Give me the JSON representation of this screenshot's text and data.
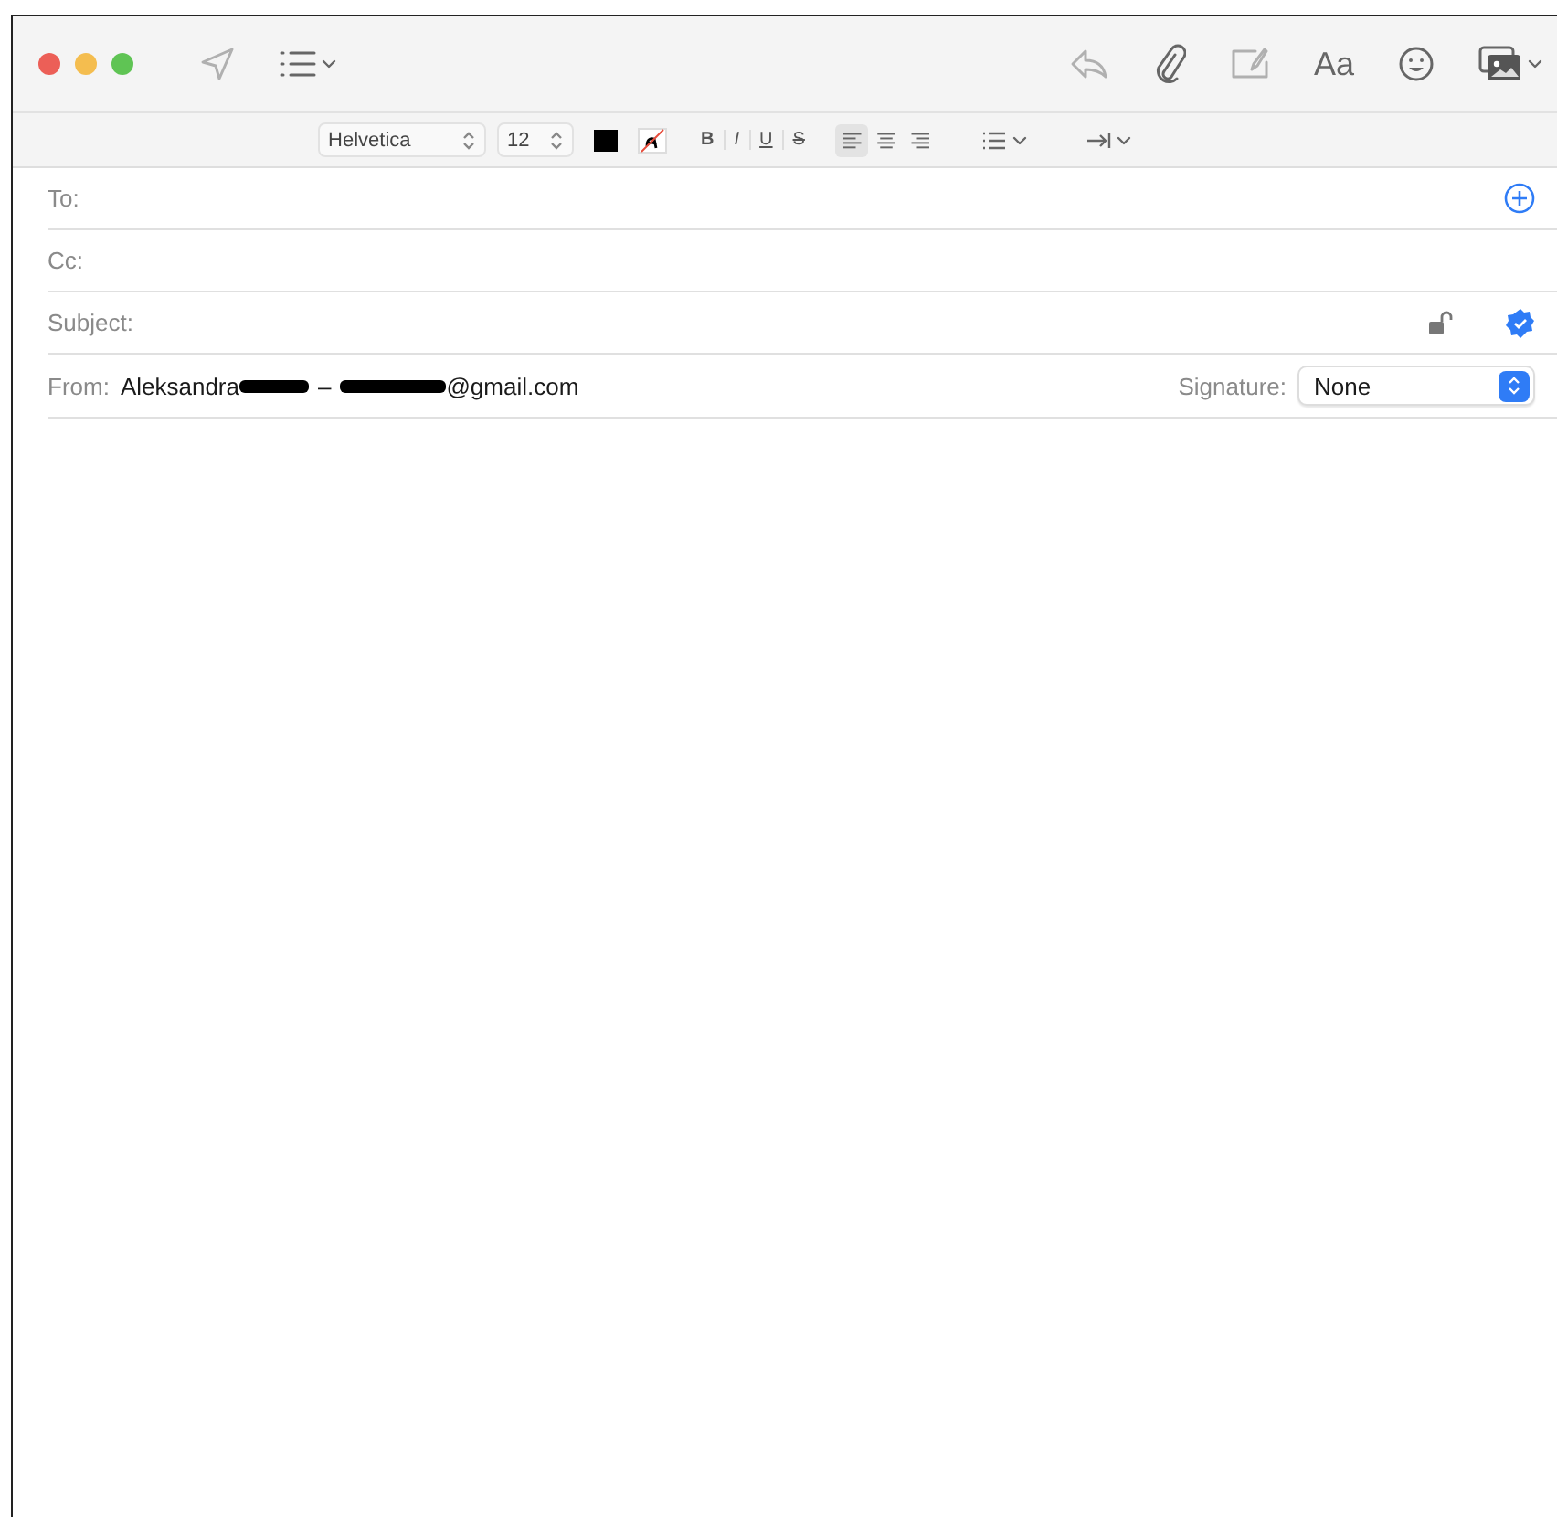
{
  "toolbar": {
    "format_button": "Aa"
  },
  "format_bar": {
    "font": "Helvetica",
    "size": "12",
    "styles": [
      {
        "label": "B",
        "kind": "bold"
      },
      {
        "label": "I",
        "kind": "italic"
      },
      {
        "label": "U",
        "kind": "underline"
      },
      {
        "label": "S",
        "kind": "strike"
      }
    ],
    "alignments": [
      {
        "kind": "left",
        "selected": true
      },
      {
        "kind": "center",
        "selected": false
      },
      {
        "kind": "right",
        "selected": false
      }
    ]
  },
  "fields": [
    {
      "label": "To:",
      "kind": "to"
    },
    {
      "label": "Cc:",
      "kind": "plain"
    },
    {
      "label": "Subject:",
      "kind": "subject"
    }
  ],
  "from": {
    "label": "From:",
    "name": "Aleksandra",
    "separator": "–",
    "email": "@gmail.com",
    "signature_label": "Signature:",
    "signature": "None"
  }
}
